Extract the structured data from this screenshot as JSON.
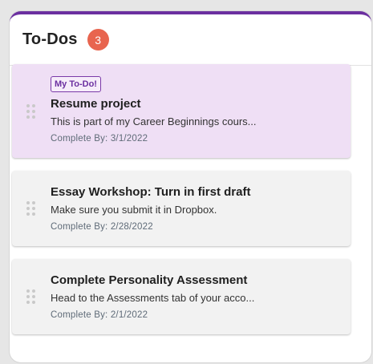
{
  "header": {
    "title": "To-Dos",
    "count": "3"
  },
  "todos": [
    {
      "tag": "My To-Do!",
      "title": "Resume project",
      "description": "This is part of my Career Beginnings cours...",
      "complete_by": "Complete By: 3/1/2022",
      "highlighted": true
    },
    {
      "title": "Essay Workshop: Turn in first draft",
      "description": "Make sure you submit it in Dropbox.",
      "complete_by": "Complete By: 2/28/2022",
      "highlighted": false
    },
    {
      "title": "Complete Personality Assessment",
      "description": "Head to the Assessments tab of your acco...",
      "complete_by": "Complete By: 2/1/2022",
      "highlighted": false
    }
  ],
  "colors": {
    "accent": "#6b2fa0",
    "badge": "#e8654f",
    "highlight_bg": "#efdff5"
  }
}
